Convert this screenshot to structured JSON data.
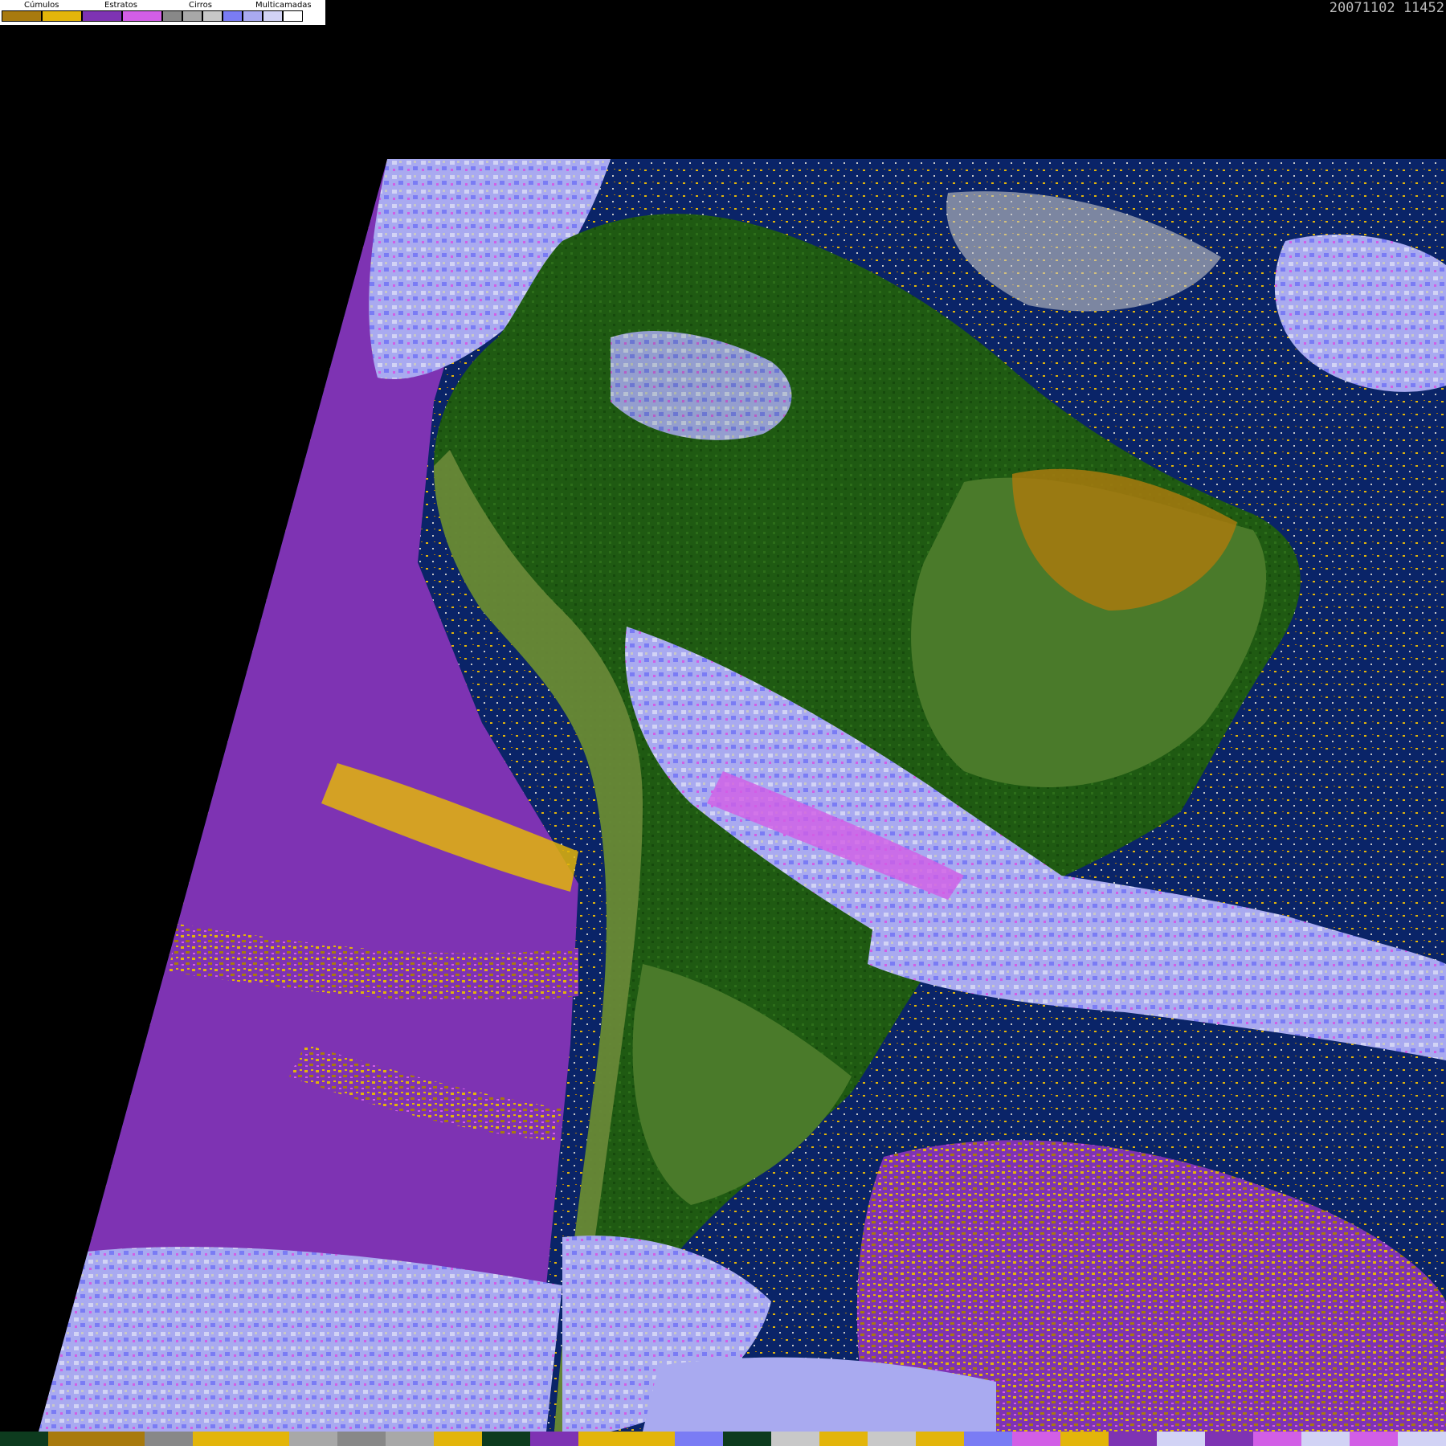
{
  "legend": {
    "groups": [
      {
        "label": "Cúmulos",
        "colors": [
          "#a87a0e",
          "#e3b50a"
        ]
      },
      {
        "label": "Estratos",
        "colors": [
          "#7e33b3",
          "#d25ee6"
        ]
      },
      {
        "label": "Cirros",
        "colors": [
          "#888888",
          "#a8a8a8",
          "#c8c8c8"
        ]
      },
      {
        "label": "Multicamadas",
        "colors": [
          "#7a7cf4",
          "#a9aaf0",
          "#d2d3f5",
          "#ffffff"
        ]
      }
    ]
  },
  "timestamp": "20071102 11452",
  "colors": {
    "background": "#000000",
    "ocean": "#0a2468",
    "land_forest": "#1f5a12",
    "land_savanna": "#4a7a2a",
    "low_cloud_stratus": "#7e33b3",
    "cumulus": "#e3b50a",
    "cumulus_dark": "#a87a0e",
    "multilayer": "#7a7cf4",
    "multilayer_light": "#d2d3f5",
    "cirrus": "#c8c8c8"
  },
  "bottom_bar": [
    "#0d3b1e",
    "#a87a0e",
    "#a87a0e",
    "#888888",
    "#e3b50a",
    "#e3b50a",
    "#a8a8a8",
    "#888888",
    "#a8a8a8",
    "#e3b50a",
    "#0d3b1e",
    "#7e33b3",
    "#e3b50a",
    "#e3b50a",
    "#7a7cf4",
    "#0d3b1e",
    "#c8c8c8",
    "#e3b50a",
    "#c8c8c8",
    "#e3b50a",
    "#7a7cf4",
    "#d25ee6",
    "#e3b50a",
    "#7e33b3",
    "#d2d3f5",
    "#7e33b3",
    "#d25ee6",
    "#d2d3f5",
    "#d25ee6",
    "#d2d3f5"
  ]
}
